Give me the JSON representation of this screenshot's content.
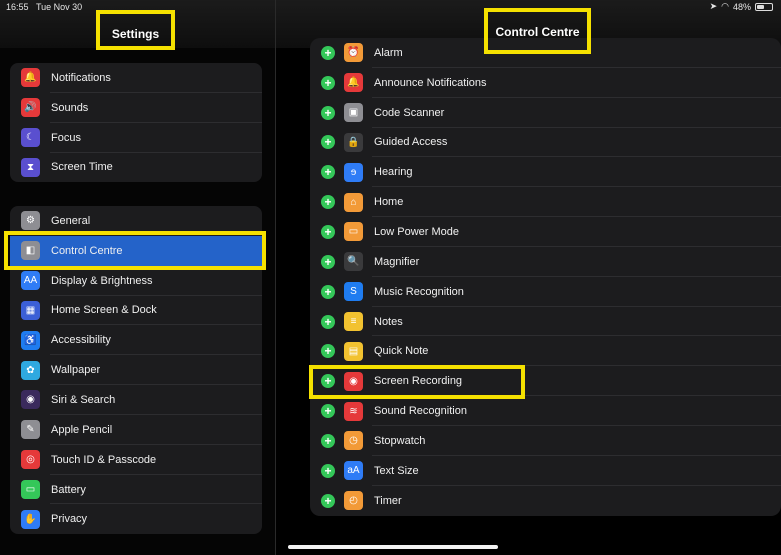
{
  "status_bar": {
    "time": "16:55",
    "date": "Tue Nov 30",
    "battery": "48%"
  },
  "left": {
    "title": "Settings",
    "group1": [
      {
        "label": "Notifications",
        "icon": "notifications-icon",
        "color": "#e5393a",
        "glyph": "🔔"
      },
      {
        "label": "Sounds",
        "icon": "sounds-icon",
        "color": "#e5393a",
        "glyph": "🔊"
      },
      {
        "label": "Focus",
        "icon": "moon-icon",
        "color": "#5a4fcf",
        "glyph": "☾"
      },
      {
        "label": "Screen Time",
        "icon": "hourglass-icon",
        "color": "#5a4fcf",
        "glyph": "⧗"
      }
    ],
    "group2": [
      {
        "label": "General",
        "icon": "gear-icon",
        "color": "#8e8e93",
        "glyph": "⚙"
      },
      {
        "label": "Control Centre",
        "icon": "switches-icon",
        "color": "#8e8e93",
        "glyph": "◧",
        "selected": true
      },
      {
        "label": "Display & Brightness",
        "icon": "display-icon",
        "color": "#2f7cf6",
        "glyph": "AA"
      },
      {
        "label": "Home Screen & Dock",
        "icon": "home-screen-icon",
        "color": "#3b5fd6",
        "glyph": "▦"
      },
      {
        "label": "Accessibility",
        "icon": "accessibility-icon",
        "color": "#1f7cf0",
        "glyph": "♿"
      },
      {
        "label": "Wallpaper",
        "icon": "wallpaper-icon",
        "color": "#2fa9e0",
        "glyph": "✿"
      },
      {
        "label": "Siri & Search",
        "icon": "siri-icon",
        "color": "#3a2a5c",
        "glyph": "◉"
      },
      {
        "label": "Apple Pencil",
        "icon": "pencil-icon",
        "color": "#8e8e93",
        "glyph": "✎"
      },
      {
        "label": "Touch ID & Passcode",
        "icon": "fingerprint-icon",
        "color": "#e5393a",
        "glyph": "◎"
      },
      {
        "label": "Battery",
        "icon": "battery-icon",
        "color": "#34c759",
        "glyph": "▭"
      },
      {
        "label": "Privacy",
        "icon": "hand-icon",
        "color": "#2f7cf6",
        "glyph": "✋"
      }
    ]
  },
  "right": {
    "title": "Control Centre",
    "items": [
      {
        "label": "Alarm",
        "icon": "alarm-icon",
        "color": "#f29a38",
        "glyph": "⏰"
      },
      {
        "label": "Announce Notifications",
        "icon": "announce-icon",
        "color": "#e5393a",
        "glyph": "🔔"
      },
      {
        "label": "Code Scanner",
        "icon": "qr-icon",
        "color": "#8e8e93",
        "glyph": "▣"
      },
      {
        "label": "Guided Access",
        "icon": "lock-icon",
        "color": "#3a3a3c",
        "glyph": "🔒"
      },
      {
        "label": "Hearing",
        "icon": "ear-icon",
        "color": "#2f7cf6",
        "glyph": "ɘ"
      },
      {
        "label": "Home",
        "icon": "home-icon",
        "color": "#f29a38",
        "glyph": "⌂"
      },
      {
        "label": "Low Power Mode",
        "icon": "low-power-icon",
        "color": "#f29a38",
        "glyph": "▭"
      },
      {
        "label": "Magnifier",
        "icon": "magnifier-icon",
        "color": "#3a3a3c",
        "glyph": "🔍"
      },
      {
        "label": "Music Recognition",
        "icon": "shazam-icon",
        "color": "#1f7cf0",
        "glyph": "S"
      },
      {
        "label": "Notes",
        "icon": "notes-icon",
        "color": "#f2c230",
        "glyph": "≡"
      },
      {
        "label": "Quick Note",
        "icon": "quick-note-icon",
        "color": "#f2c230",
        "glyph": "▤"
      },
      {
        "label": "Screen Recording",
        "icon": "record-icon",
        "color": "#e5393a",
        "glyph": "◉"
      },
      {
        "label": "Sound Recognition",
        "icon": "waveform-icon",
        "color": "#e5393a",
        "glyph": "≋"
      },
      {
        "label": "Stopwatch",
        "icon": "stopwatch-icon",
        "color": "#f29a38",
        "glyph": "◷"
      },
      {
        "label": "Text Size",
        "icon": "text-size-icon",
        "color": "#2f7cf6",
        "glyph": "aA"
      },
      {
        "label": "Timer",
        "icon": "timer-icon",
        "color": "#f29a38",
        "glyph": "◴"
      }
    ]
  },
  "highlight_color": "#f5e100",
  "selected_color": "#2463c9"
}
